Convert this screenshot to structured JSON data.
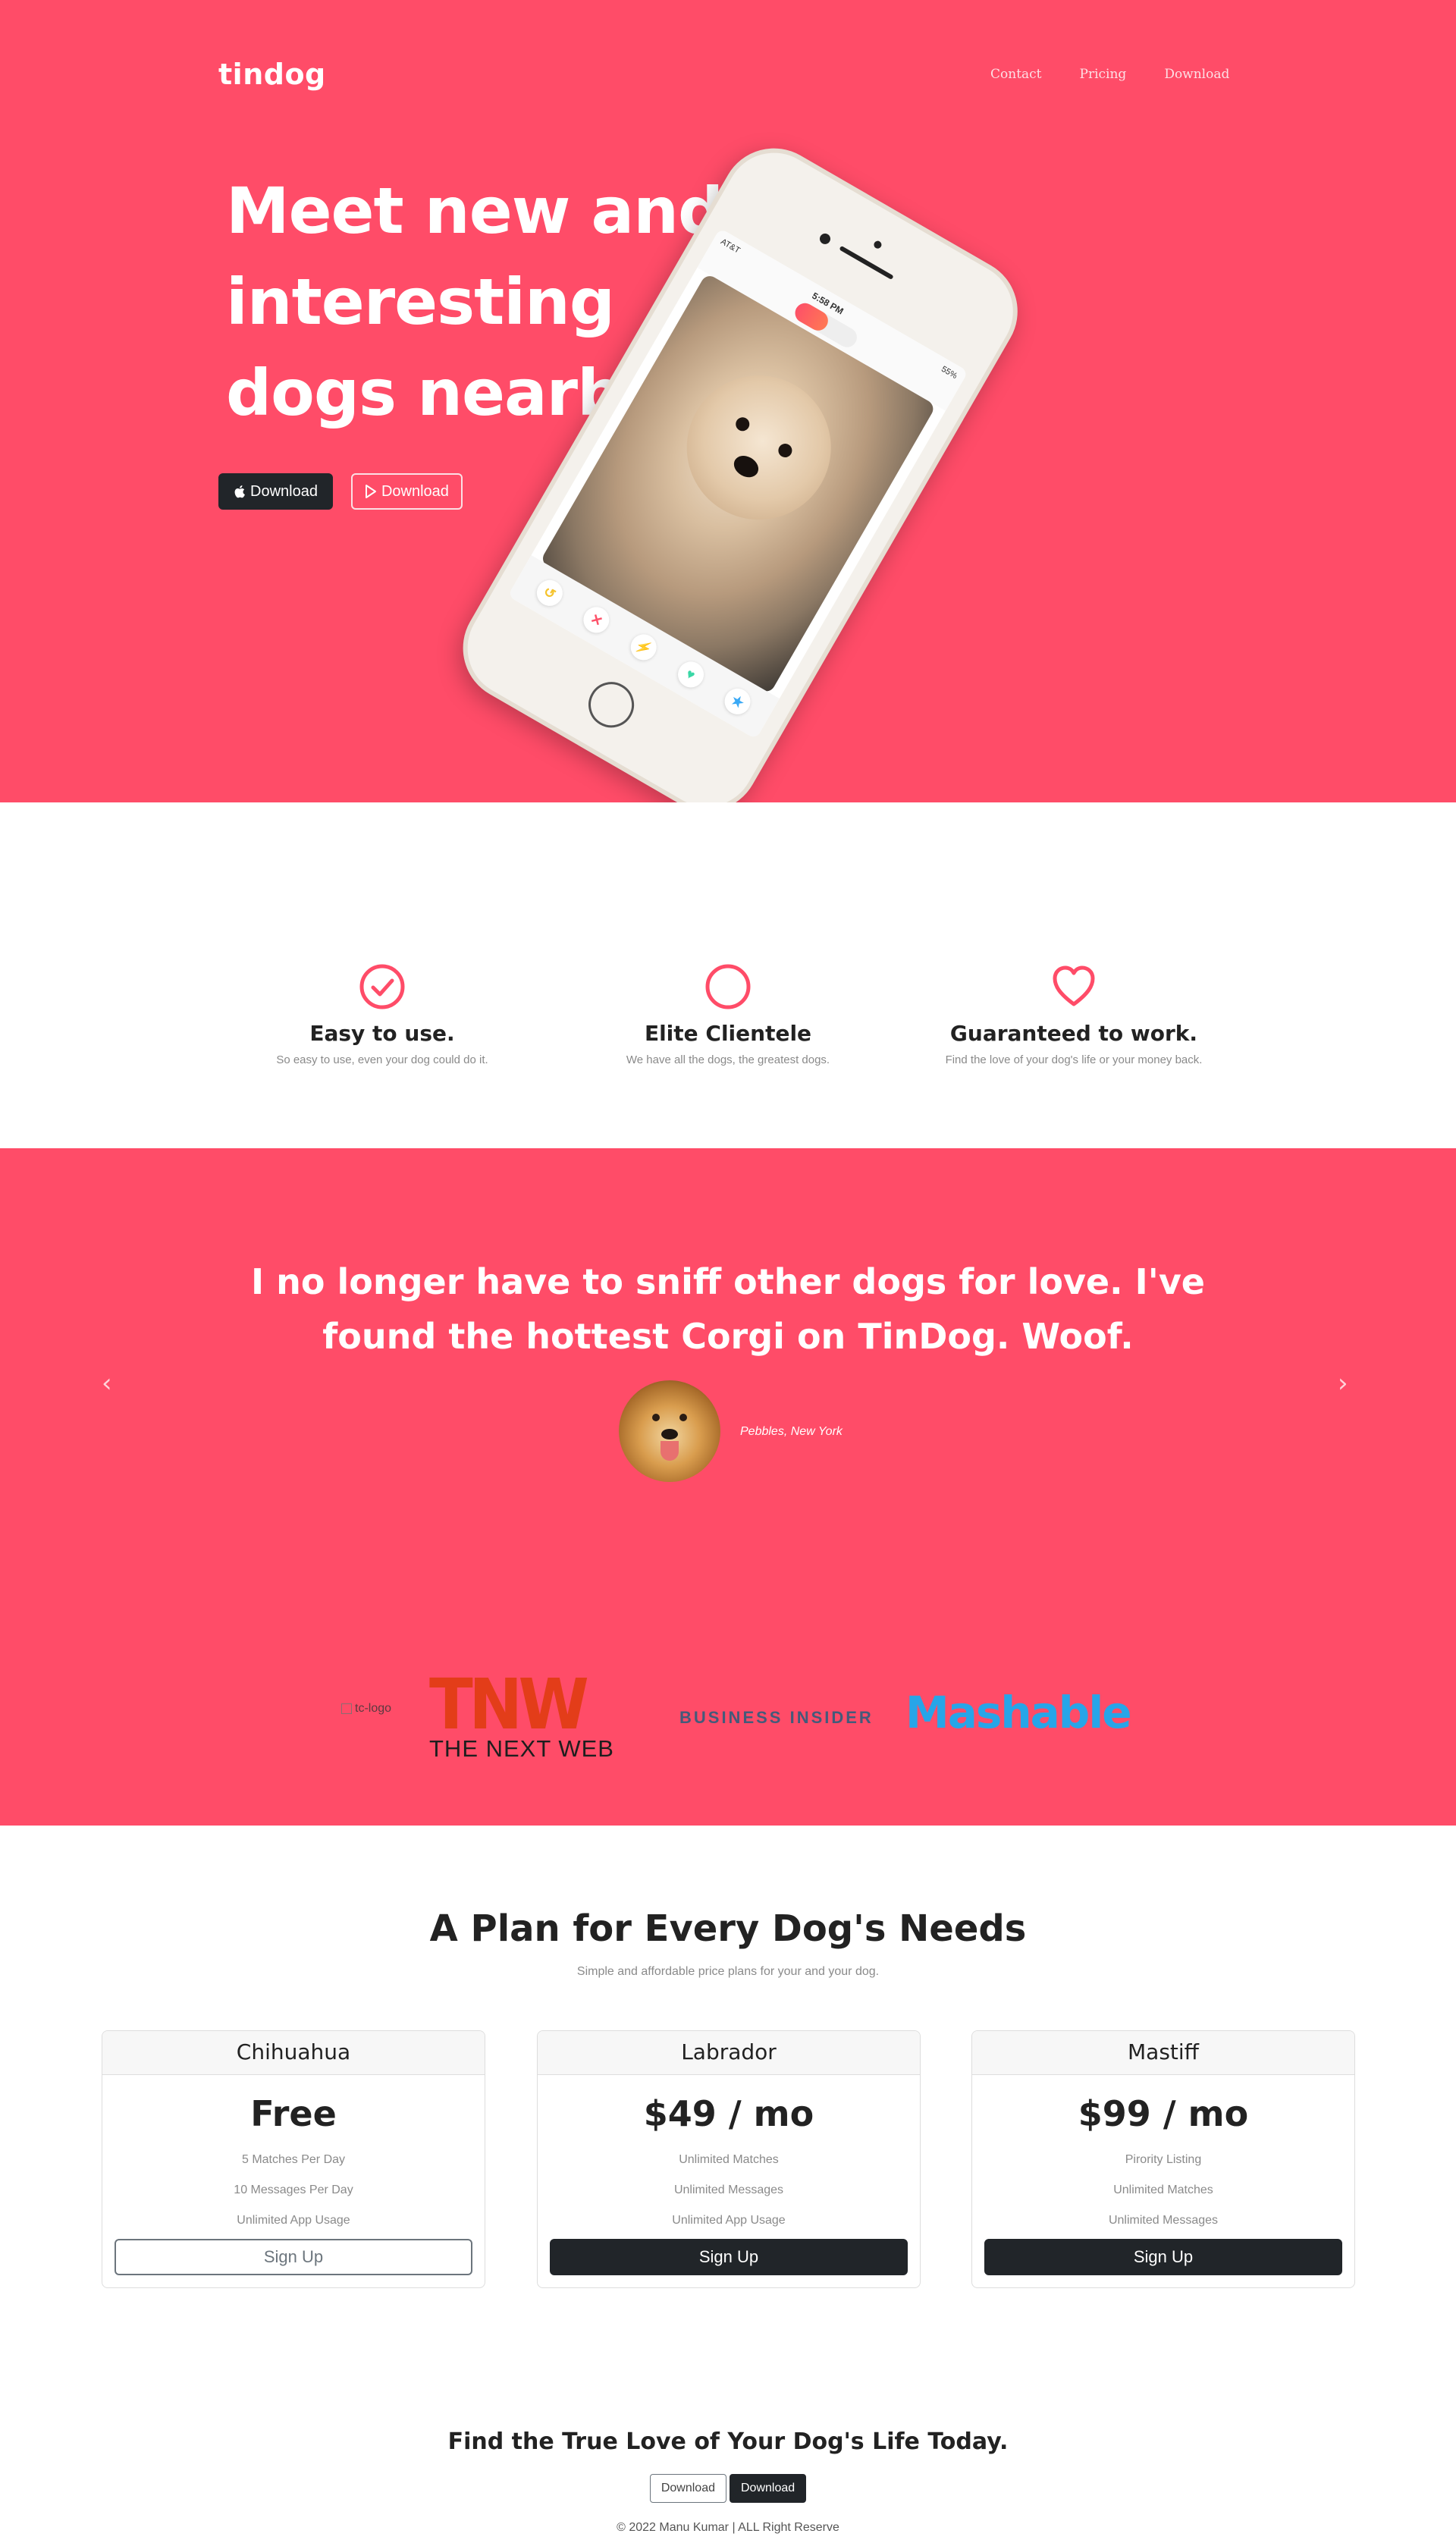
{
  "brand": "tindog",
  "nav": [
    "Contact",
    "Pricing",
    "Download"
  ],
  "hero": {
    "headline": "Meet new and interesting dogs nearby.",
    "btn_apple": "Download",
    "btn_play": "Download"
  },
  "phone": {
    "carrier": "AT&T",
    "time": "5:58 PM",
    "battery": "55%"
  },
  "features": [
    {
      "icon": "check-circle-icon",
      "title": "Easy to use.",
      "text": "So easy to use, even your dog could do it."
    },
    {
      "icon": "circle-icon",
      "title": "Elite Clientele",
      "text": "We have all the dogs, the greatest dogs."
    },
    {
      "icon": "heart-icon",
      "title": "Guaranteed to work.",
      "text": "Find the love of your dog's life or your money back."
    }
  ],
  "testimonial": {
    "quote": "I no longer have to sniff other dogs for love. I've found the hottest Corgi on TinDog. Woof.",
    "author": "Pebbles, New York"
  },
  "press": {
    "tc_alt": "tc-logo",
    "tnw_big": "TNW",
    "tnw_small": "THE NEXT WEB",
    "bi": "BUSINESS INSIDER",
    "mashable": "Mashable"
  },
  "pricing": {
    "title": "A Plan for Every Dog's Needs",
    "subtitle": "Simple and affordable price plans for your and your dog.",
    "plans": [
      {
        "name": "Chihuahua",
        "price": "Free",
        "features": [
          "5 Matches Per Day",
          "10 Messages Per Day",
          "Unlimited App Usage"
        ],
        "cta": "Sign Up"
      },
      {
        "name": "Labrador",
        "price": "$49 / mo",
        "features": [
          "Unlimited Matches",
          "Unlimited Messages",
          "Unlimited App Usage"
        ],
        "cta": "Sign Up"
      },
      {
        "name": "Mastiff",
        "price": "$99 / mo",
        "features": [
          "Pirority Listing",
          "Unlimited Matches",
          "Unlimited Messages"
        ],
        "cta": "Sign Up"
      }
    ]
  },
  "footer": {
    "title": "Find the True Love of Your Dog's Life Today.",
    "btn1": "Download",
    "btn2": "Download",
    "copyright": "© 2022 Manu Kumar | ALL Right Reserve"
  },
  "colors": {
    "brand_pink": "#ff4c68",
    "dark": "#212529"
  }
}
